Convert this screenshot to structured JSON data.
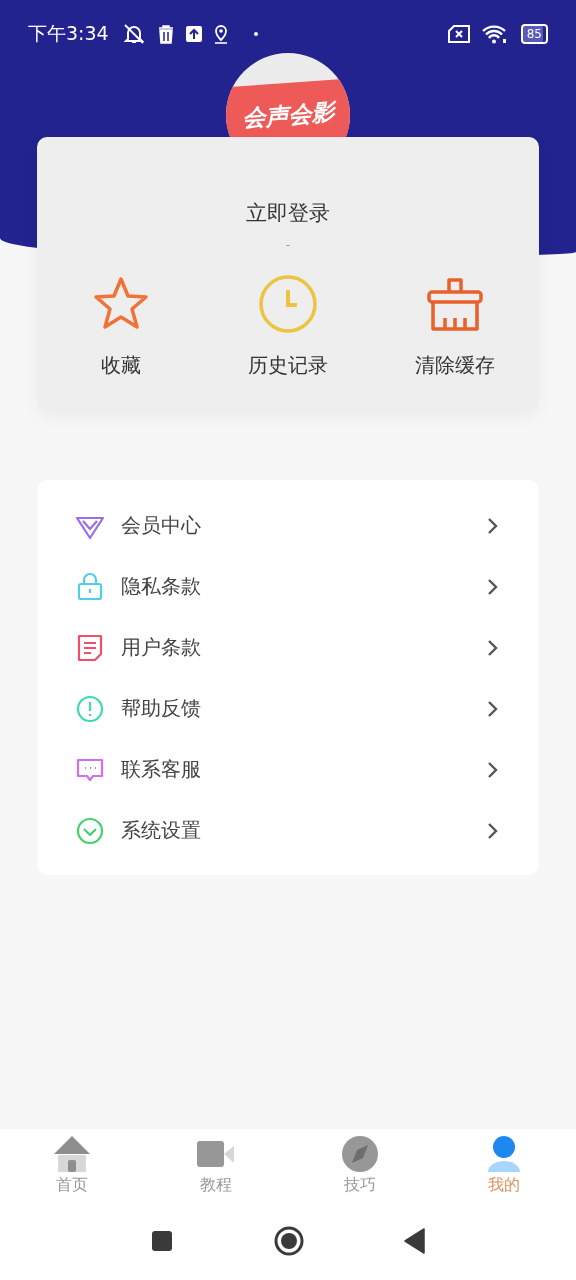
{
  "status_bar": {
    "time": "下午3:34",
    "battery": "85"
  },
  "logo": {
    "text": "会声会影"
  },
  "login_card": {
    "title": "立即登录",
    "subtitle": "-",
    "actions": [
      {
        "label": "收藏",
        "kind": "star",
        "color": "#f07236"
      },
      {
        "label": "历史记录",
        "kind": "clock",
        "color": "#efc33f"
      },
      {
        "label": "清除缓存",
        "kind": "brush",
        "color": "#e8602a"
      }
    ]
  },
  "menu": [
    {
      "label": "会员中心",
      "kind": "diamond",
      "color": "#9b6cf0"
    },
    {
      "label": "隐私条款",
      "kind": "lock",
      "color": "#4dcfe8"
    },
    {
      "label": "用户条款",
      "kind": "doc",
      "color": "#f0506a"
    },
    {
      "label": "帮助反馈",
      "kind": "alert",
      "color": "#3fd8b6"
    },
    {
      "label": "联系客服",
      "kind": "chat",
      "color": "#d070f0"
    },
    {
      "label": "系统设置",
      "kind": "check",
      "color": "#43d06e"
    }
  ],
  "tabs": [
    {
      "label": "首页",
      "kind": "home",
      "selected": false
    },
    {
      "label": "教程",
      "kind": "video",
      "selected": false
    },
    {
      "label": "技巧",
      "kind": "compass",
      "selected": false
    },
    {
      "label": "我的",
      "kind": "person",
      "selected": true
    }
  ]
}
